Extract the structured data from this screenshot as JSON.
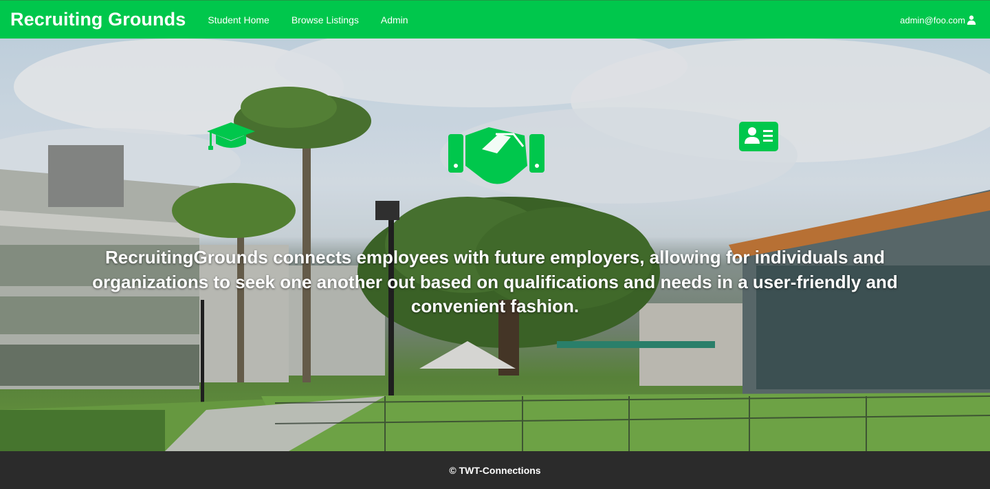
{
  "navbar": {
    "brand": "Recruiting Grounds",
    "links": [
      {
        "label": "Student Home"
      },
      {
        "label": "Browse Listings"
      },
      {
        "label": "Admin"
      }
    ],
    "user_email": "admin@foo.com",
    "user_icon": "user-icon",
    "background_color": "#00c74c"
  },
  "hero": {
    "icons": [
      "graduation-cap-icon",
      "handshake-icon",
      "id-card-icon"
    ],
    "icon_color": "#00c74c",
    "tagline": "RecruitingGrounds connects employees with future employers, allowing for individuals and organizations to seek one another out based on qualifications and needs in a user-friendly and convenient fashion."
  },
  "footer": {
    "copyright": "© TWT-Connections",
    "background_color": "#2b2b2b"
  }
}
